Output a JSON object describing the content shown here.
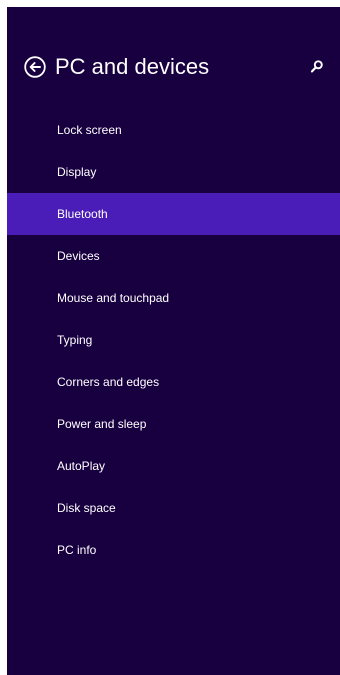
{
  "header": {
    "title": "PC and devices",
    "back_icon": "back-arrow-circle-icon",
    "search_icon": "search-icon"
  },
  "colors": {
    "panel_background": "#180040",
    "selected_background": "#4a1cb8",
    "text": "#ffffff"
  },
  "nav": {
    "items": [
      {
        "label": "Lock screen",
        "selected": false
      },
      {
        "label": "Display",
        "selected": false
      },
      {
        "label": "Bluetooth",
        "selected": true
      },
      {
        "label": "Devices",
        "selected": false
      },
      {
        "label": "Mouse and touchpad",
        "selected": false
      },
      {
        "label": "Typing",
        "selected": false
      },
      {
        "label": "Corners and edges",
        "selected": false
      },
      {
        "label": "Power and sleep",
        "selected": false
      },
      {
        "label": "AutoPlay",
        "selected": false
      },
      {
        "label": "Disk space",
        "selected": false
      },
      {
        "label": "PC info",
        "selected": false
      }
    ]
  }
}
